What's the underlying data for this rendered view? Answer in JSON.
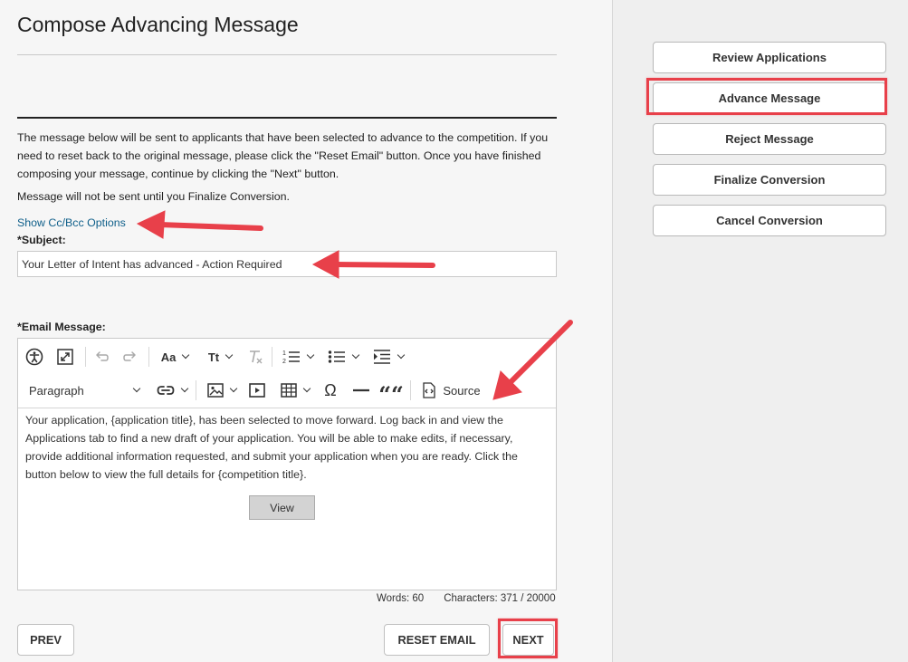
{
  "page": {
    "title": "Compose Advancing Message",
    "intro": "The message below will be sent to applicants that have been selected to advance to the competition. If you need to reset back to the original message, please click the \"Reset Email\" button. Once you have finished composing your message, continue by clicking the \"Next\" button.",
    "note": "Message will not be sent until you Finalize Conversion.",
    "cc_link": "Show Cc/Bcc Options",
    "subject_label": "*Subject:",
    "subject_value": "Your Letter of Intent has advanced - Action Required",
    "email_label": "*Email Message:"
  },
  "editor": {
    "toolbar": {
      "accessibility_icon": "accessibility-icon",
      "fullscreen_icon": "maximize-icon",
      "undo_icon": "undo-icon",
      "redo_icon": "redo-icon",
      "font_family": "Aa",
      "font_size": "Tt",
      "clear_format_icon": "clear-format-icon",
      "numbered_list_icon": "numbered-list-icon",
      "bulleted_list_icon": "bulleted-list-icon",
      "indent_icon": "indent-icon",
      "heading": "Paragraph",
      "link_icon": "link-icon",
      "image_icon": "image-icon",
      "media_icon": "media-icon",
      "table_icon": "table-icon",
      "special_char": "Ω",
      "hr_icon": "horizontal-line-icon",
      "quote": "““",
      "source": "Source"
    },
    "body": "Your application, {application title}, has been selected to move forward. Log back in and view the Applications tab to find a new draft of your application. You will be able to make edits, if necessary, provide additional information requested, and submit your application when you are ready. Click the button below to view the full details for {competition title}.",
    "view_button": "View",
    "words": "Words: 60",
    "characters": "Characters: 371 / 20000"
  },
  "footer": {
    "prev": "PREV",
    "reset": "RESET EMAIL",
    "next": "NEXT"
  },
  "sidebar": {
    "items": [
      {
        "label": "Review Applications"
      },
      {
        "label": "Advance Message"
      },
      {
        "label": "Reject Message"
      },
      {
        "label": "Finalize Conversion"
      },
      {
        "label": "Cancel Conversion"
      }
    ]
  },
  "colors": {
    "highlight": "#e8404a",
    "link": "#0f5f8a",
    "background": "#f6f6f6",
    "sidebar_background": "#efefef"
  }
}
